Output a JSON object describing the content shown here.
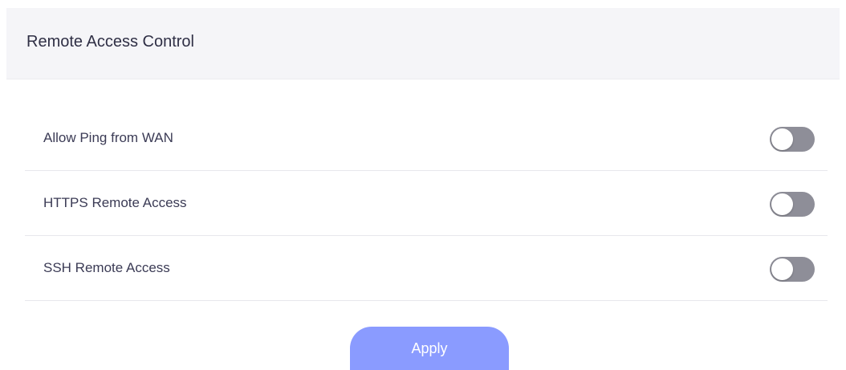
{
  "header": {
    "title": "Remote Access Control"
  },
  "settings": [
    {
      "label": "Allow Ping from WAN",
      "enabled": false,
      "icon": "toggle-switch"
    },
    {
      "label": "HTTPS Remote Access",
      "enabled": false,
      "icon": "toggle-switch"
    },
    {
      "label": "SSH Remote Access",
      "enabled": false,
      "icon": "toggle-switch"
    }
  ],
  "actions": {
    "apply_label": "Apply"
  },
  "colors": {
    "header_bg": "#f5f5f8",
    "toggle_off": "#8e8e98",
    "apply_button": "#8a9bff",
    "divider": "#e7e7ec"
  }
}
